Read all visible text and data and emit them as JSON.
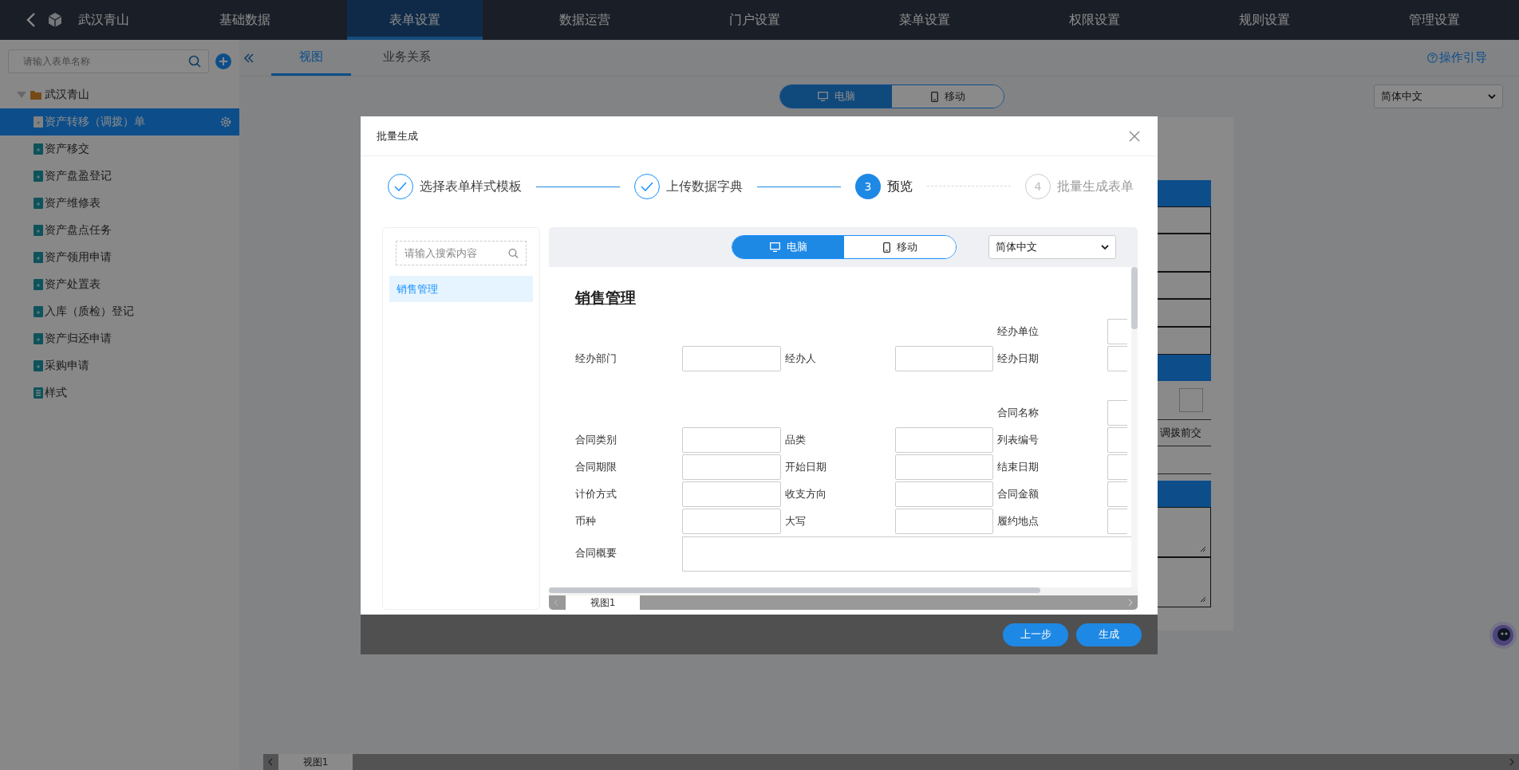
{
  "topbar": {
    "brand": "武汉青山",
    "nav": [
      {
        "label": "基础数据",
        "selected": false
      },
      {
        "label": "表单设置",
        "selected": true
      },
      {
        "label": "数据运营",
        "selected": false
      },
      {
        "label": "门户设置",
        "selected": false
      },
      {
        "label": "菜单设置",
        "selected": false
      },
      {
        "label": "权限设置",
        "selected": false
      },
      {
        "label": "规则设置",
        "selected": false
      },
      {
        "label": "管理设置",
        "selected": false
      }
    ]
  },
  "sidebar": {
    "search": {
      "placeholder": "请输入表单名称"
    },
    "tree": [
      {
        "label": "武汉青山",
        "kind": "folder",
        "expanded": true,
        "selected": false,
        "children": [
          {
            "label": "资产转移（调拨）单",
            "kind": "form",
            "selected": true
          },
          {
            "label": "资产移交",
            "kind": "form",
            "selected": false
          },
          {
            "label": "资产盘盈登记",
            "kind": "form",
            "selected": false
          },
          {
            "label": "资产维修表",
            "kind": "form",
            "selected": false
          },
          {
            "label": "资产盘点任务",
            "kind": "form",
            "selected": false
          },
          {
            "label": "资产领用申请",
            "kind": "form",
            "selected": false
          },
          {
            "label": "资产处置表",
            "kind": "form",
            "selected": false
          },
          {
            "label": "入库（质检）登记",
            "kind": "form",
            "selected": false
          },
          {
            "label": "资产归还申请",
            "kind": "form",
            "selected": false
          },
          {
            "label": "采购申请",
            "kind": "form",
            "selected": false
          },
          {
            "label": "样式",
            "kind": "style",
            "selected": false
          }
        ]
      }
    ]
  },
  "main": {
    "tabs": [
      {
        "label": "视图",
        "selected": true
      },
      {
        "label": "业务关系",
        "selected": false
      }
    ],
    "guide_link": "操作引导",
    "device_toggle": [
      {
        "label": "电脑",
        "selected": true
      },
      {
        "label": "移动",
        "selected": false
      }
    ],
    "language": "简体中文",
    "canvas": {
      "cut_text": "调拨前交"
    },
    "view_tabs": [
      {
        "label": "视图1",
        "selected": true
      }
    ]
  },
  "dialog": {
    "title": "批量生成",
    "steps": [
      {
        "label": "选择表单样式模板",
        "completed": true,
        "active": false
      },
      {
        "label": "上传数据字典",
        "completed": true,
        "active": false
      },
      {
        "number": "3",
        "label": "预览",
        "completed": false,
        "active": true
      },
      {
        "number": "4",
        "label": "批量生成表单",
        "completed": false,
        "active": false
      }
    ],
    "search": {
      "placeholder": "请输入搜索内容"
    },
    "list": [
      {
        "label": "销售管理",
        "selected": true
      }
    ],
    "preview": {
      "device_toggle": [
        {
          "label": "电脑",
          "selected": true
        },
        {
          "label": "移动",
          "selected": false
        }
      ],
      "language": "简体中文",
      "form_title": "销售管理",
      "rows": [
        {
          "kind": "fields",
          "cells": [
            null,
            null,
            {
              "label": "经办单位"
            }
          ]
        },
        {
          "kind": "fields",
          "cells": [
            {
              "label": "经办部门"
            },
            {
              "label": "经办人"
            },
            {
              "label": "经办日期"
            }
          ]
        },
        {
          "kind": "spacer"
        },
        {
          "kind": "fields",
          "cells": [
            null,
            null,
            {
              "label": "合同名称"
            }
          ]
        },
        {
          "kind": "fields",
          "cells": [
            {
              "label": "合同类别"
            },
            {
              "label": "品类"
            },
            {
              "label": "列表编号"
            }
          ]
        },
        {
          "kind": "fields",
          "cells": [
            {
              "label": "合同期限"
            },
            {
              "label": "开始日期"
            },
            {
              "label": "结束日期"
            }
          ]
        },
        {
          "kind": "fields",
          "cells": [
            {
              "label": "计价方式"
            },
            {
              "label": "收支方向"
            },
            {
              "label": "合同金额"
            }
          ]
        },
        {
          "kind": "fields",
          "cells": [
            {
              "label": "币种"
            },
            {
              "label": "大写"
            },
            {
              "label": "履约地点"
            }
          ]
        },
        {
          "kind": "textarea",
          "label": "合同概要"
        }
      ],
      "view_tabs": [
        {
          "label": "视图1",
          "selected": true
        }
      ]
    },
    "buttons": [
      "上一步",
      "生成"
    ]
  }
}
